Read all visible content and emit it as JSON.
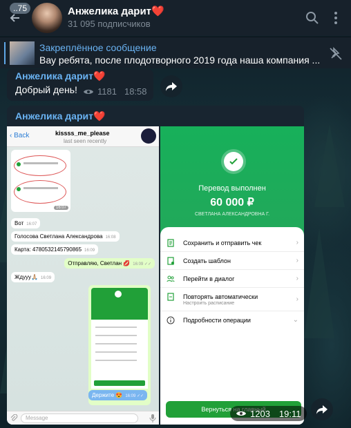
{
  "header": {
    "unread_count": "..75",
    "channel_name": "Анжелика дарит❤️",
    "subscribers": "31 095 подписчиков"
  },
  "pinned": {
    "title": "Закреплённое сообщение",
    "text": "Вау ребята, после плодотворного 2019 года наша компания ..."
  },
  "messages": [
    {
      "sender": "Анжелика дарит❤️",
      "text": "Добрый день!",
      "views": "1181",
      "time": "18:58"
    },
    {
      "sender": "Анжелика дарит❤️",
      "views": "1203",
      "time": "19:11",
      "left_screenshot": {
        "back": "Back",
        "contact": "kissss_me_please",
        "status": "last seen recently",
        "bubbles": [
          {
            "text": "Вот",
            "time": "16:07",
            "out": false
          },
          {
            "text": "Голосова Светлана Александрова",
            "time": "16:08",
            "out": false
          },
          {
            "text": "Карта: 4780532145790865",
            "time": "16:09",
            "out": false
          },
          {
            "text": "Отправляю, Светлан 💋",
            "time": "16:09 ✓✓",
            "out": true
          },
          {
            "text": "Ждууу🙏🏼",
            "time": "16:09",
            "out": false
          },
          {
            "text": "Держите 😍",
            "time": "16:09 ✓✓",
            "out": true
          }
        ],
        "image_time": "16:07",
        "input_placeholder": "Message"
      },
      "right_screenshot": {
        "status_title": "Перевод выполнен",
        "amount": "60 000 ₽",
        "recipient": "СВЕТЛАНА АЛЕКСАНДРОВНА Г.",
        "rows": [
          {
            "label": "Сохранить и отправить чек",
            "sub": ""
          },
          {
            "label": "Создать шаблон",
            "sub": ""
          },
          {
            "label": "Перейти в диалог",
            "sub": ""
          },
          {
            "label": "Повторять автоматически",
            "sub": "Настроить расписание"
          },
          {
            "label": "Подробности операции",
            "sub": ""
          }
        ],
        "button": "Вернуться на главный"
      }
    }
  ],
  "colors": {
    "accent": "#6ab3f3",
    "header_bg": "#17212b",
    "bubble_bg": "#182530",
    "sber_green": "#21a038"
  }
}
